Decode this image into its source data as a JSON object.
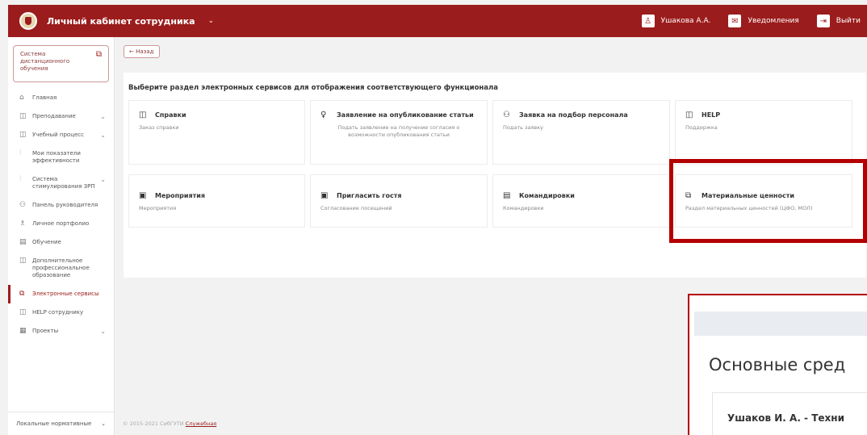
{
  "header": {
    "title": "Личный кабинет сотрудника",
    "caret": "⌄",
    "user_name": "Ушакова А.А.",
    "notifications_label": "Уведомления",
    "logout_label": "Выйти"
  },
  "sidebar": {
    "system_box": "Система дистанционного обучения",
    "items": [
      {
        "icon": "⌂",
        "label": "Главная",
        "chev": ""
      },
      {
        "icon": "◫",
        "label": "Преподавание",
        "chev": "⌄"
      },
      {
        "icon": "◫",
        "label": "Учебный процесс",
        "chev": "⌄"
      },
      {
        "icon": "⫶",
        "label": "Мои показатели эффективности",
        "chev": ""
      },
      {
        "icon": "⫶",
        "label": "Система стимулирования ЗРП",
        "chev": "⌄"
      },
      {
        "icon": "⚇",
        "label": "Панель руководителя",
        "chev": ""
      },
      {
        "icon": "♗",
        "label": "Личное портфолио",
        "chev": ""
      },
      {
        "icon": "▤",
        "label": "Обучение",
        "chev": ""
      },
      {
        "icon": "◫",
        "label": "Дополнительное профессиональное образование",
        "chev": ""
      },
      {
        "icon": "⧉",
        "label": "Электронные сервисы",
        "chev": ""
      },
      {
        "icon": "◫",
        "label": "HELP сотруднику",
        "chev": ""
      },
      {
        "icon": "▦",
        "label": "Проекты",
        "chev": "⌄"
      }
    ],
    "bottom_label": "Локальные нормативные",
    "bottom_chev": "⌄"
  },
  "main": {
    "back_label": "← Назад",
    "panel_title": "Выберите раздел электронных сервисов для отображения соответствующего функционала",
    "cards": [
      {
        "icon": "◫",
        "title": "Справки",
        "desc": "Заказ справки"
      },
      {
        "icon": "♀",
        "title": "Заявление на опубликование статьи",
        "desc": "Подать заявление на получение согласия о возможности опубликования статьи"
      },
      {
        "icon": "⚇",
        "title": "Заявка на подбор персонала",
        "desc": "Подать заявку"
      },
      {
        "icon": "◫",
        "title": "HELP",
        "desc": "Поддержка"
      },
      {
        "icon": "▣",
        "title": "Мероприятия",
        "desc": "Мероприятия"
      },
      {
        "icon": "▣",
        "title": "Пригласить гостя",
        "desc": "Согласование посещений"
      },
      {
        "icon": "▤",
        "title": "Командировки",
        "desc": "Командировки"
      },
      {
        "icon": "⧉",
        "title": "Материальные ценности",
        "desc": "Раздел материальных ценностей (ЦФО, МОЛ)"
      }
    ]
  },
  "footer": {
    "copyright": "© 2015-2021 СибГУТИ",
    "link": "Служебная"
  },
  "inset": {
    "title": "Основные сред",
    "row": "Ушаков И. А. - Техни"
  }
}
